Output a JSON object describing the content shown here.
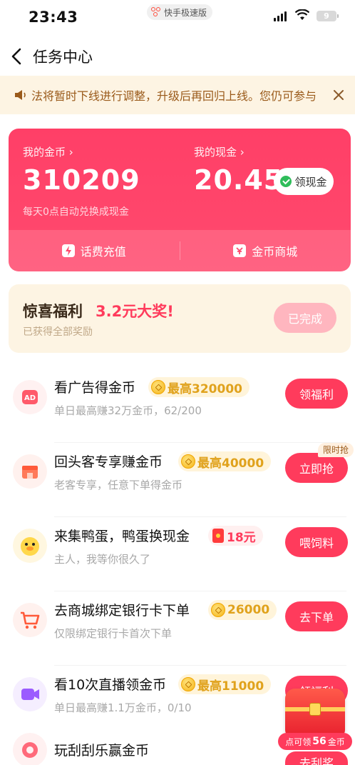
{
  "status_bar": {
    "time": "23:43",
    "app_name": "快手极速版",
    "battery": "9"
  },
  "header": {
    "title": "任务中心"
  },
  "notice": {
    "text": "法将暂时下线进行调整，升级后再回归上线。您仍可参与"
  },
  "wallet": {
    "coins_label": "我的金币 ›",
    "coins_value": "310209",
    "coins_note": "每天0点自动兑换成现金",
    "cash_label": "我的现金 ›",
    "cash_value": "20.45",
    "claim_cash_label": "领现金",
    "phone_topup_label": "话费充值",
    "coin_mall_label": "金币商城"
  },
  "surprise": {
    "title": "惊喜福利",
    "prize": "3.2元大奖!",
    "subtitle": "已获得全部奖励",
    "button": "已完成"
  },
  "tasks": [
    {
      "title": "看广告得金币",
      "badge": "最高320000",
      "badge_type": "coin",
      "subtitle": "单日最高赚32万金币，62/200",
      "button": "领福利",
      "icon": "ad-icon"
    },
    {
      "title": "回头客专享赚金币",
      "badge": "最高40000",
      "badge_type": "coin",
      "subtitle": "老客专享，任意下单得金币",
      "button": "立即抢",
      "tag": "限时抢",
      "icon": "shop-icon"
    },
    {
      "title": "来集鸭蛋，鸭蛋换现金",
      "badge": "18元",
      "badge_type": "red-envelope",
      "subtitle": "主人，我等你很久了",
      "button": "喂饲料",
      "icon": "duck-icon"
    },
    {
      "title": "去商城绑定银行卡下单",
      "badge": "26000",
      "badge_type": "coin",
      "subtitle": "仅限绑定银行卡首次下单",
      "button": "去下单",
      "icon": "cart-icon"
    },
    {
      "title": "看10次直播领金币",
      "badge": "最高11000",
      "badge_type": "coin",
      "subtitle": "单日最高赚1.1万金币，0/10",
      "button": "领福利",
      "icon": "live-video-icon"
    },
    {
      "title": "玩刮刮乐赢金币",
      "button": "去刮奖",
      "icon": "scratch-card-icon"
    }
  ],
  "floating_reward": {
    "prefix": "点可领",
    "amount": "56",
    "suffix": "金币"
  }
}
